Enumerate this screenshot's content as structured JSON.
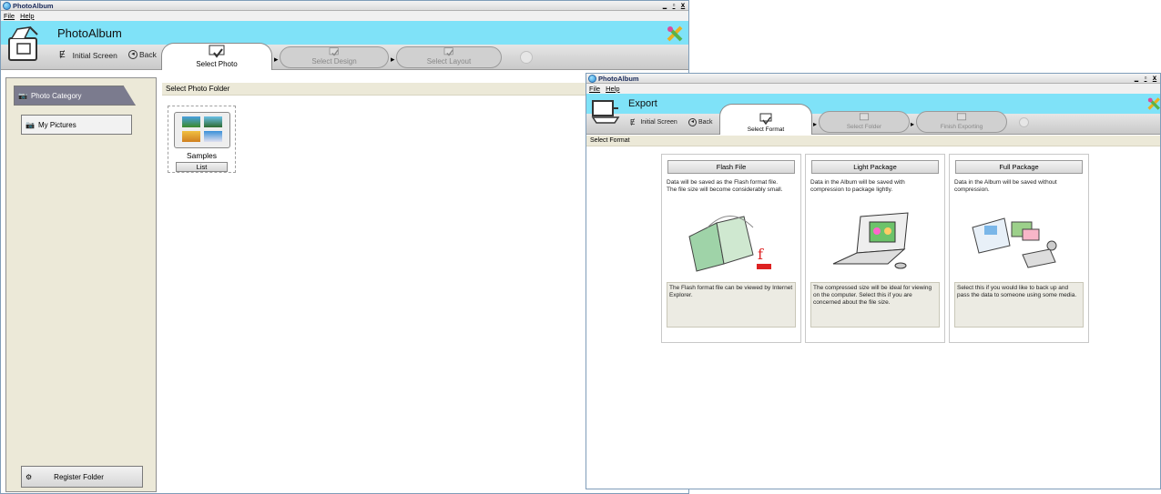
{
  "window1": {
    "title": "PhotoAlbum",
    "controls": [
      "_",
      "̅",
      "x"
    ],
    "menu": [
      "File",
      "Help"
    ],
    "app_title": "PhotoAlbum",
    "nav": {
      "initial": "Initial Screen",
      "back": "Back"
    },
    "tabs": [
      {
        "label": "Select Photo",
        "active": true
      },
      {
        "label": "Select Design",
        "active": false
      },
      {
        "label": "Select Layout",
        "active": false
      }
    ],
    "left_panel": {
      "categories": [
        "Photo Category",
        "My Pictures"
      ],
      "register_button": "Register Folder"
    },
    "content": {
      "header": "Select Photo Folder",
      "folders": [
        {
          "name": "Samples",
          "action": "List"
        }
      ]
    }
  },
  "window2": {
    "title": "PhotoAlbum",
    "menu": [
      "File",
      "Help"
    ],
    "app_title": "Export",
    "nav": {
      "initial": "Initial Screen",
      "back": "Back"
    },
    "tabs": [
      {
        "label": "Select Format",
        "active": true
      },
      {
        "label": "Select Folder",
        "active": false
      },
      {
        "label": "Finish Exporting",
        "active": false
      }
    ],
    "header": "Select Format",
    "formats": [
      {
        "button": "Flash File",
        "desc": "Data will be saved as the Flash format file.\nThe file size will become considerably small.",
        "note": "The Flash format file can be viewed by Internet Explorer."
      },
      {
        "button": "Light Package",
        "desc": "Data in the Album will be saved with compression to package lightly.",
        "note": "The compressed size will be ideal for viewing on the computer.  Select this if you are concerned about the file size."
      },
      {
        "button": "Full Package",
        "desc": "Data in the Album will be saved without compression.",
        "note": "Select this if you would like to back up and pass the data to someone using some media."
      }
    ]
  },
  "colors": {
    "banner": "#7fe2f8",
    "panel": "#ece9d8"
  }
}
